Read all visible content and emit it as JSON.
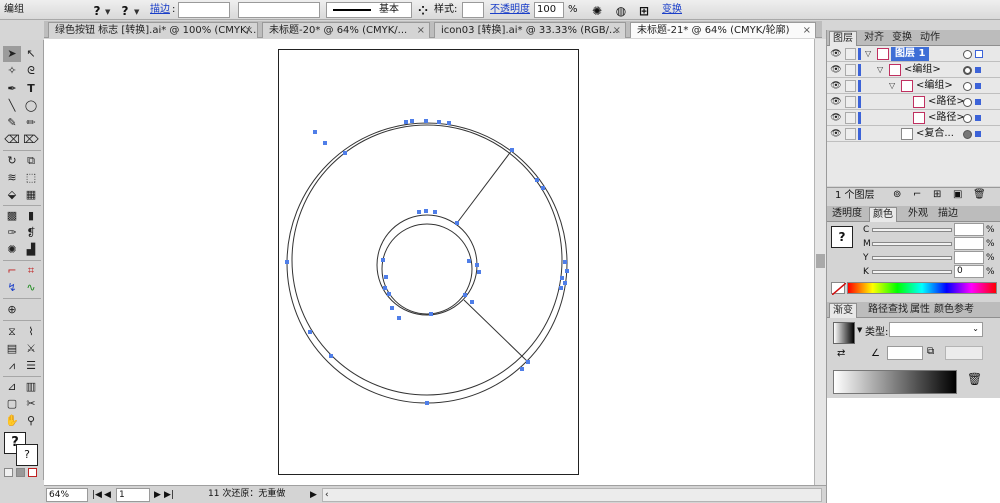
{
  "control_bar": {
    "selection_label": "编组",
    "stroke_label": "描边",
    "stroke_value": "",
    "brush_value": "基本",
    "style_label": "样式:",
    "opacity_label": "不透明度",
    "opacity_value": "100",
    "opacity_unit": "%",
    "transform_label": "变换"
  },
  "tabs": [
    {
      "label": "绿色按钮 标志 [转换].ai* @ 100% (CMYK/..."
    },
    {
      "label": "未标题-20* @ 64% (CMYK/..."
    },
    {
      "label": "icon03 [转换].ai* @ 33.33% (RGB/..."
    },
    {
      "label": "未标题-21* @ 64% (CMYK/轮廓)"
    }
  ],
  "status_bar": {
    "zoom": "64%",
    "page": "1",
    "undo_status": "11 次还原：无重做"
  },
  "layers_panel": {
    "tabs": [
      "图层",
      "对齐",
      "变换",
      "动作"
    ],
    "rows": [
      {
        "name": "图层 1"
      },
      {
        "name": "<编组>"
      },
      {
        "name": "<编组>"
      },
      {
        "name": "<路径>"
      },
      {
        "name": "<路径>"
      },
      {
        "name": "<复合..."
      }
    ],
    "footer_text": "1 个图层"
  },
  "color_panel": {
    "tabs": [
      "透明度",
      "颜色",
      "外观",
      "描边"
    ],
    "channels": [
      {
        "label": "C",
        "value": ""
      },
      {
        "label": "M",
        "value": ""
      },
      {
        "label": "Y",
        "value": ""
      },
      {
        "label": "K",
        "value": "0"
      }
    ],
    "unit": "%"
  },
  "gradient_panel": {
    "tabs": [
      "渐变",
      "路径查找",
      "属性",
      "颜色参考"
    ],
    "type_label": "类型:",
    "type_value": ""
  },
  "colors": {
    "selection_blue": "#3c63d8",
    "anchor_blue": "#4f7ee8"
  }
}
